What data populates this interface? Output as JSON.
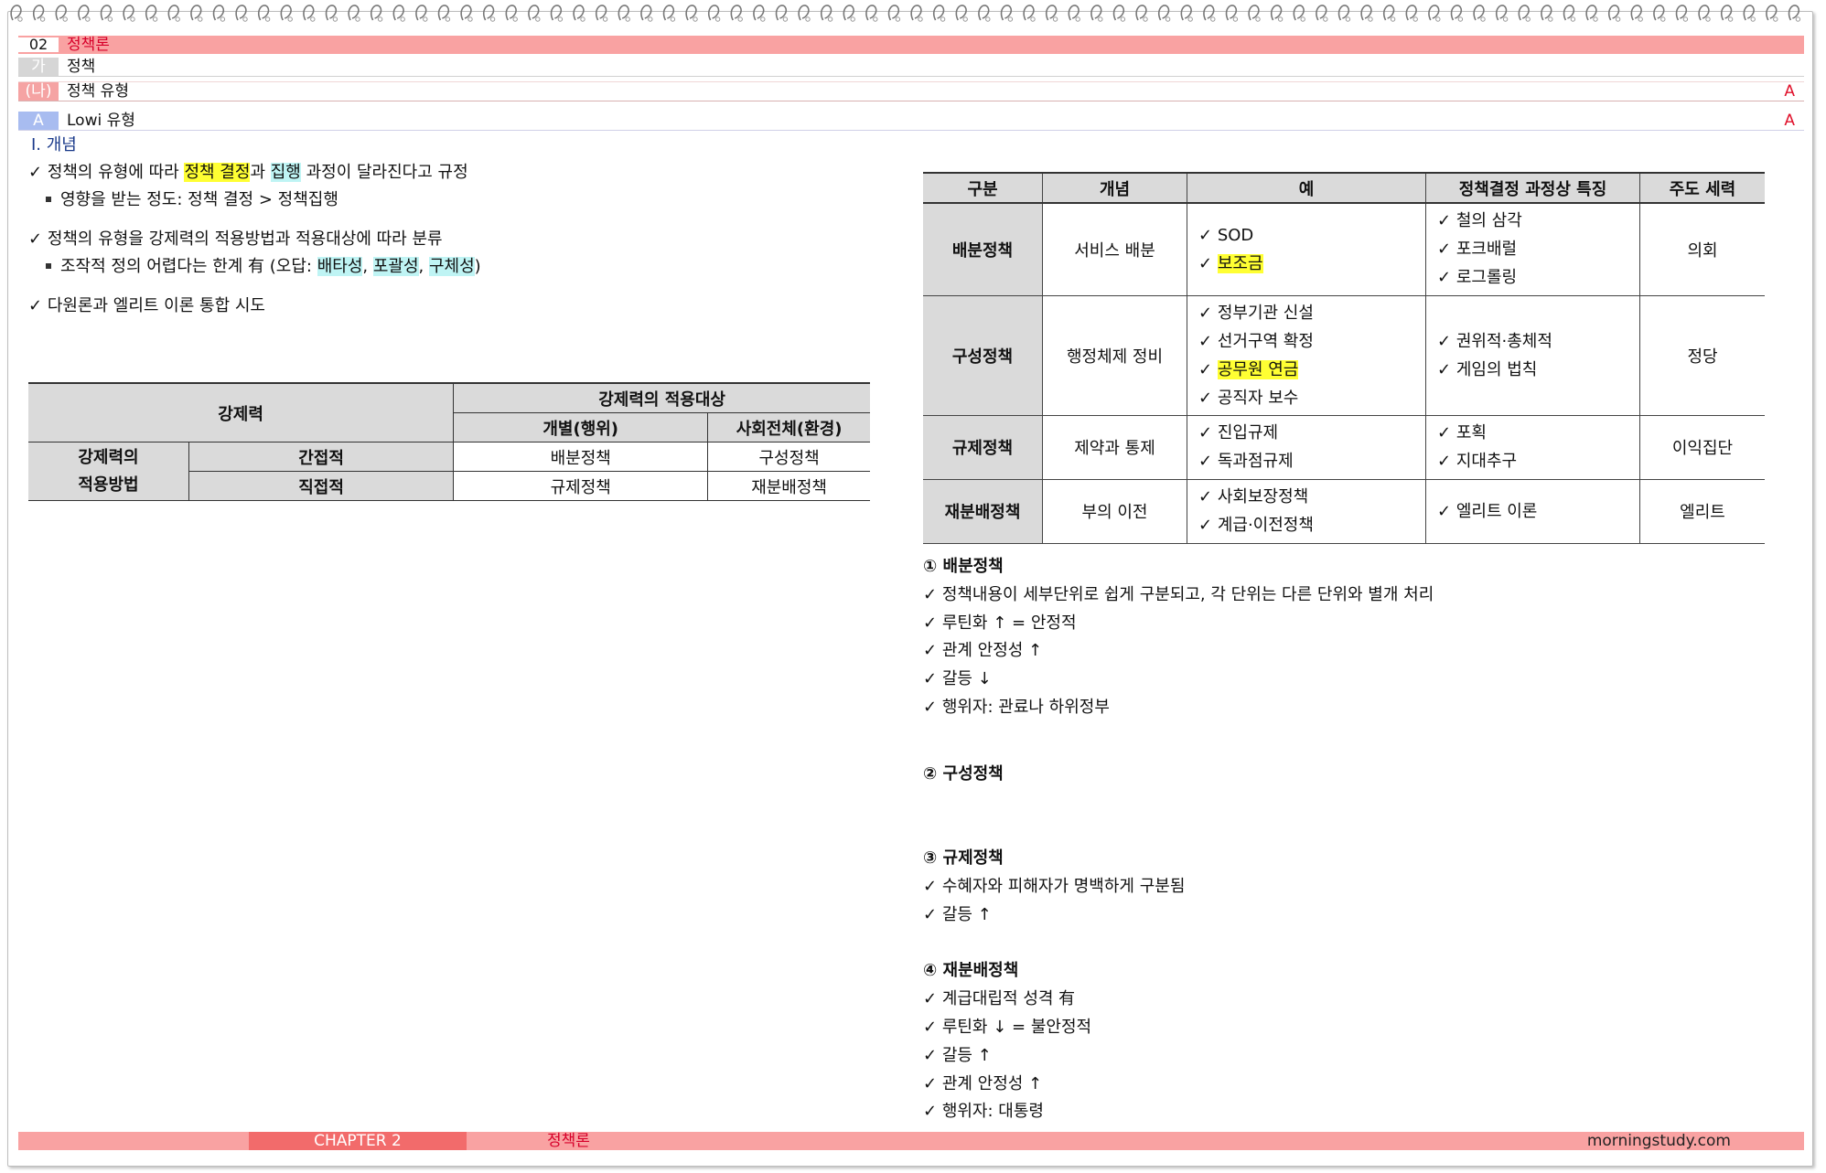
{
  "header": {
    "chapter": {
      "tag": "02",
      "title": "정책론"
    },
    "section": {
      "tag": "가",
      "title": "정책"
    },
    "subsection": {
      "tag": "(나)",
      "title": "정책 유형",
      "level": "A"
    },
    "topic": {
      "tag": "A",
      "title": "Lowi 유형",
      "level": "A"
    }
  },
  "concept": {
    "heading": "Ⅰ. 개념",
    "line1_pre": "정책의 유형에 따라 ",
    "line1_hl1": "정책 결정",
    "line1_mid": "과 ",
    "line1_hl2": "집행",
    "line1_post": " 과정이 달라진다고 규정",
    "sub1": "영향을 받는 정도: 정책 결정 > 정책집행",
    "line2": "정책의 유형을 강제력의 적용방법과 적용대상에 따라 분류",
    "sub2_pre": "조작적 정의 어렵다는 한계 有 (오답: ",
    "sub2_hl1": "배타성",
    "sub2_sep1": ", ",
    "sub2_hl2": "포괄성",
    "sub2_sep2": ", ",
    "sub2_hl3": "구체성",
    "sub2_post": ")",
    "line3": "다원론과 엘리트 이론 통합 시도"
  },
  "left_table": {
    "corner": "강제력",
    "target_header": "강제력의 적용대상",
    "col1": "개별(행위)",
    "col2": "사회전체(환경)",
    "method_l1": "강제력의",
    "method_l2": "적용방법",
    "row1_label": "간접적",
    "row1_c1": "배분정책",
    "row1_c2": "구성정책",
    "row2_label": "직접적",
    "row2_c1": "규제정책",
    "row2_c2": "재분배정책"
  },
  "right_table": {
    "headers": [
      "구분",
      "개념",
      "예",
      "정책결정 과정상 특징",
      "주도 세력"
    ],
    "rows": [
      {
        "type": "배분정책",
        "concept": "서비스 배분",
        "examples": [
          "SOD",
          "보조금"
        ],
        "features": [
          "철의 삼각",
          "포크배럴",
          "로그롤링"
        ],
        "actor": "의회"
      },
      {
        "type": "구성정책",
        "concept": "행정체제 정비",
        "examples": [
          "정부기관 신설",
          "선거구역 확정",
          "공무원 연금",
          "공직자 보수"
        ],
        "features": [
          "권위적·총체적",
          "게임의 법칙"
        ],
        "actor": "정당"
      },
      {
        "type": "규제정책",
        "concept": "제약과 통제",
        "examples": [
          "진입규제",
          "독과점규제"
        ],
        "features": [
          "포획",
          "지대추구"
        ],
        "actor": "이익집단"
      },
      {
        "type": "재분배정책",
        "concept": "부의 이전",
        "examples": [
          "사회보장정책",
          "계급·이전정책"
        ],
        "features": [
          "엘리트 이론"
        ],
        "actor": "엘리트"
      }
    ],
    "check": "✓"
  },
  "notes": {
    "n1_title": "① 배분정책",
    "n1": [
      "정책내용이 세부단위로 쉽게 구분되고, 각 단위는 다른 단위와 별개 처리",
      "루틴화 ↑ = 안정적",
      "관계 안정성 ↑",
      "갈등 ↓",
      "행위자: 관료나 하위정부"
    ],
    "n2_title": "② 구성정책",
    "n3_title": "③ 규제정책",
    "n3": [
      "수혜자와 피해자가 명백하게 구분됨",
      "갈등 ↑"
    ],
    "n4_title": "④ 재분배정책",
    "n4": [
      "계급대립적 성격 有",
      "루틴화 ↓ = 불안정적",
      "갈등 ↑",
      "관계 안정성 ↑",
      "행위자: 대통령"
    ]
  },
  "footer": {
    "chapter": "CHAPTER 2",
    "title": "정책론",
    "site": "morningstudy.com"
  }
}
